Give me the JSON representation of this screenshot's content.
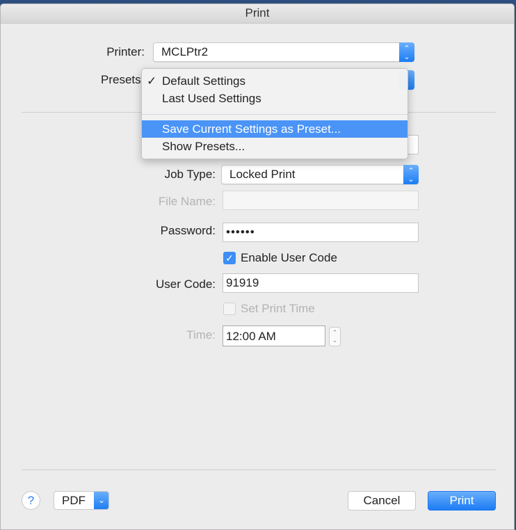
{
  "window": {
    "title": "Print"
  },
  "printer": {
    "label": "Printer:",
    "value": "MCLPtr2"
  },
  "presets": {
    "label": "Presets:",
    "menu": [
      {
        "label": "Default Settings",
        "checked": true
      },
      {
        "label": "Last Used Settings"
      },
      {
        "label": "Save Current Settings as Preset...",
        "highlighted": true
      },
      {
        "label": "Show Presets..."
      }
    ]
  },
  "job_type": {
    "label": "Job Type:",
    "value": "Locked Print"
  },
  "file_name": {
    "label": "File Name:",
    "value": "",
    "disabled": true
  },
  "password": {
    "label": "Password:",
    "value": "••••••"
  },
  "enable_user_code": {
    "label": "Enable User Code",
    "checked": true
  },
  "user_code": {
    "label": "User Code:",
    "value": "91919"
  },
  "set_print_time": {
    "label": "Set Print Time",
    "checked": false,
    "disabled": true
  },
  "time": {
    "label": "Time:",
    "value": "12:00 AM",
    "disabled": true
  },
  "footer": {
    "help": "?",
    "pdf": "PDF",
    "cancel": "Cancel",
    "print": "Print"
  },
  "colors": {
    "accent": "#1c7cf4",
    "highlight": "#4a94f7"
  }
}
